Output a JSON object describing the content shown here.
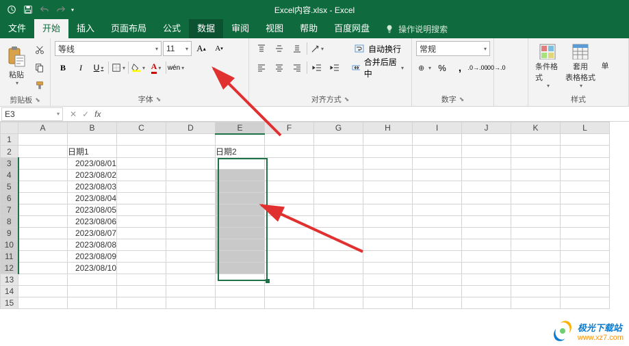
{
  "app": {
    "title": "Excel内容.xlsx - Excel"
  },
  "qat": {
    "auto_save": "auto-save-icon",
    "save": "save-icon",
    "undo": "undo-icon",
    "redo": "redo-icon"
  },
  "tabs": {
    "file": "文件",
    "home": "开始",
    "insert": "插入",
    "page_layout": "页面布局",
    "formulas": "公式",
    "data": "数据",
    "review": "审阅",
    "view": "视图",
    "help": "帮助",
    "baidu": "百度网盘",
    "tellme": "操作说明搜索"
  },
  "ribbon": {
    "clipboard": {
      "label": "剪贴板",
      "paste": "粘贴"
    },
    "font": {
      "label": "字体",
      "name": "等线",
      "size": "11",
      "bold": "B",
      "italic": "I",
      "underline": "U",
      "phonetic": "wén"
    },
    "align": {
      "label": "对齐方式",
      "wrap": "自动换行",
      "merge": "合并后居中"
    },
    "number": {
      "label": "数字",
      "format": "常规"
    },
    "styles": {
      "label": "样式",
      "cond": "条件格式",
      "table": "套用\n表格格式",
      "cell": "单"
    }
  },
  "formula": {
    "namebox": "E3",
    "fx": "fx",
    "value": ""
  },
  "grid": {
    "cols": [
      "A",
      "B",
      "C",
      "D",
      "E",
      "F",
      "G",
      "H",
      "I",
      "J",
      "K",
      "L"
    ],
    "rows": [
      "1",
      "2",
      "3",
      "4",
      "5",
      "6",
      "7",
      "8",
      "9",
      "10",
      "11",
      "12",
      "13",
      "14",
      "15"
    ],
    "cells": {
      "B2": "日期1",
      "E2": "日期2",
      "B3": "2023/08/01",
      "B4": "2023/08/02",
      "B5": "2023/08/03",
      "B6": "2023/08/04",
      "B7": "2023/08/05",
      "B8": "2023/08/06",
      "B9": "2023/08/07",
      "B10": "2023/08/08",
      "B11": "2023/08/09",
      "B12": "2023/08/10"
    },
    "selection": {
      "active": "E3",
      "range": "E3:E12"
    }
  },
  "watermark": {
    "main": "极光下载站",
    "sub": "www.xz7.com"
  }
}
